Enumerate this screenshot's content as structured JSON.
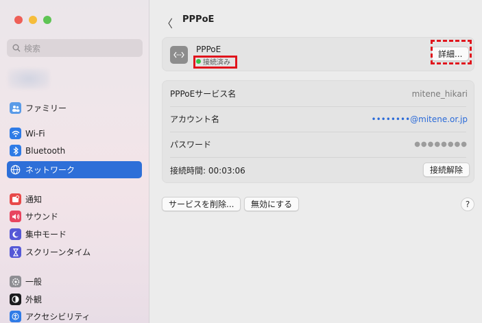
{
  "window": {
    "traffic_lights": [
      "#ee5f57",
      "#f6bd3b",
      "#5fc454"
    ]
  },
  "sidebar": {
    "search_placeholder": "検索",
    "items": [
      {
        "label": "ファミリー",
        "icon": "family-icon",
        "color": "#5a9be8"
      },
      {
        "label": "Wi-Fi",
        "icon": "wifi-icon",
        "color": "#2f7be6"
      },
      {
        "label": "Bluetooth",
        "icon": "bluetooth-icon",
        "color": "#2f7be6"
      },
      {
        "label": "ネットワーク",
        "icon": "network-icon",
        "color": "#2f7be6",
        "active": true
      },
      {
        "label": "通知",
        "icon": "notifications-icon",
        "color": "#e84a4a"
      },
      {
        "label": "サウンド",
        "icon": "sound-icon",
        "color": "#e8455f"
      },
      {
        "label": "集中モード",
        "icon": "focus-icon",
        "color": "#5558d6"
      },
      {
        "label": "スクリーンタイム",
        "icon": "screentime-icon",
        "color": "#5558d6"
      },
      {
        "label": "一般",
        "icon": "general-icon",
        "color": "#8e8e93"
      },
      {
        "label": "外観",
        "icon": "appearance-icon",
        "color": "#1c1c1e"
      },
      {
        "label": "アクセシビリティ",
        "icon": "accessibility-icon",
        "color": "#2f7be6"
      }
    ]
  },
  "header": {
    "back": "〈",
    "title": "PPPoE"
  },
  "connection": {
    "name": "PPPoE",
    "status": "接続済み",
    "details_button": "詳細..."
  },
  "details": {
    "rows": [
      {
        "label": "PPPoEサービス名",
        "value": "mitene_hikari"
      },
      {
        "label": "アカウント名",
        "value_masked": "••••••••",
        "value_domain": "@mitene.or.jp"
      },
      {
        "label": "パスワード",
        "value": "●●●●●●●●"
      },
      {
        "label": "接続時間:",
        "time": "00:03:06",
        "button": "接続解除"
      }
    ]
  },
  "actions": {
    "delete_service": "サービスを削除...",
    "disable": "無効にする",
    "help": "?"
  }
}
